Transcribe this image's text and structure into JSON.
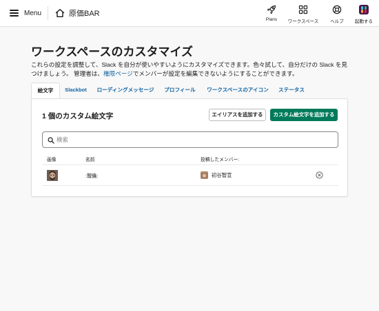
{
  "topbar": {
    "menu_label": "Menu",
    "workspace_name": "原価BAR",
    "nav": {
      "plans": "Plans",
      "workspace": "ワークスペース",
      "help": "ヘルプ",
      "launch": "起動する"
    }
  },
  "page": {
    "title": "ワークスペースのカスタマイズ",
    "desc_before_link": "これらの設定を調整して、Slack を自分が使いやすいようにカスタマイズできます。色々試して、自分だけの Slack を見つけましょう。 管理者は、",
    "desc_link": "権限ページ",
    "desc_after_link": "でメンバーが設定を編集できないようにすることができます。"
  },
  "tabs": [
    {
      "label": "絵文字",
      "active": true
    },
    {
      "label": "Slackbot"
    },
    {
      "label": "ローディングメッセージ"
    },
    {
      "label": "プロフィール"
    },
    {
      "label": "ワークスペースのアイコン"
    },
    {
      "label": "ステータス"
    }
  ],
  "emoji_panel": {
    "title": "1 個のカスタム絵文字",
    "add_alias_label": "エイリアスを追加する",
    "add_custom_label": "カスタム絵文字を追加する",
    "search_placeholder": "検索",
    "columns": {
      "image": "画像",
      "name": "名前",
      "uploader": "投稿したメンバー:"
    },
    "rows": [
      {
        "name": ":報倫:",
        "uploader": "初谷智宣"
      }
    ]
  },
  "colors": {
    "accent_green": "#007a5a",
    "link_blue": "#1264a3",
    "launch_icon_bg": "#4a154b"
  },
  "icons": [
    "menu-icon",
    "home-icon",
    "rocket-icon",
    "grid-icon",
    "help-lifebuoy-icon",
    "slack-app-icon",
    "search-icon",
    "remove-circle-icon"
  ]
}
